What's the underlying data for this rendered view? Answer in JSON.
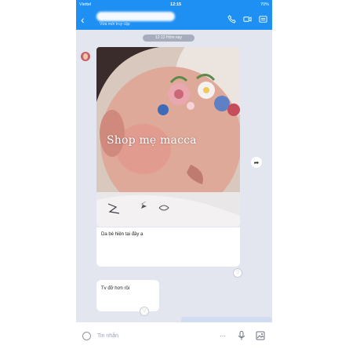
{
  "status_bar": {
    "carrier": "Viettel",
    "time": "12:15",
    "battery": "70%"
  },
  "header": {
    "subtitle": "Vừa mới truy cập"
  },
  "time_separator": "12:12 Hôm nay",
  "photo": {
    "watermark": "Shop mẹ macca"
  },
  "messages": [
    {
      "text": "Da bé hiện tại đây ạ"
    },
    {
      "text": "Tv đỡ hơn rồi"
    }
  ],
  "input": {
    "placeholder": "Tin nhắn"
  },
  "colors": {
    "accent": "#1e8ff3",
    "chat_bg": "#e3e6ef"
  }
}
